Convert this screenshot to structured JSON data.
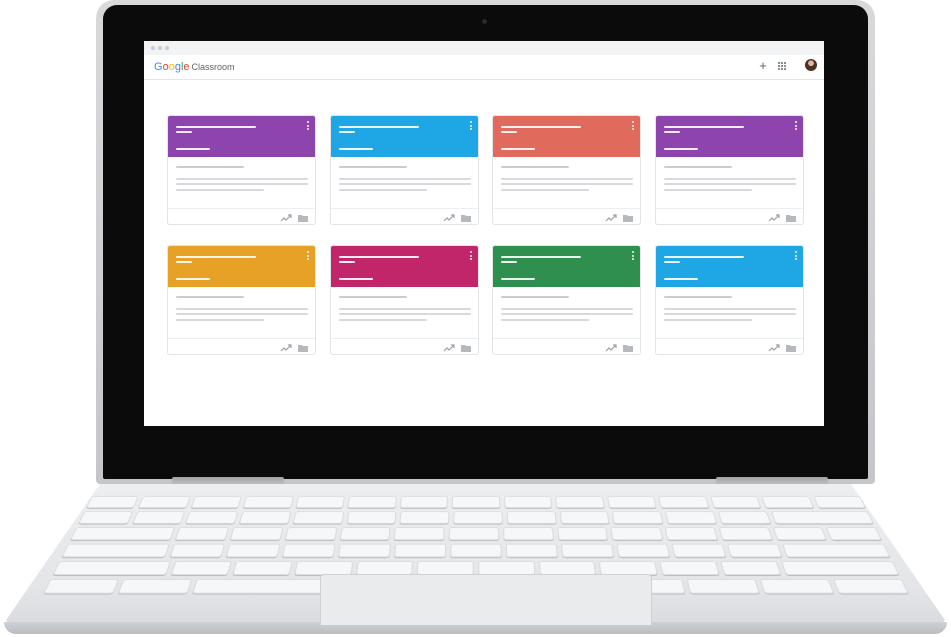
{
  "app": {
    "logo_letters": [
      {
        "char": "G",
        "color": "#4285f4"
      },
      {
        "char": "o",
        "color": "#ea4335"
      },
      {
        "char": "o",
        "color": "#fbbc05"
      },
      {
        "char": "g",
        "color": "#4285f4"
      },
      {
        "char": "l",
        "color": "#34a853"
      },
      {
        "char": "e",
        "color": "#ea4335"
      }
    ],
    "product_name": "Classroom"
  },
  "toolbar": {
    "icons": [
      "plus-icon",
      "apps-grid-icon",
      "avatar"
    ],
    "plus_glyph": "+"
  },
  "cards": [
    {
      "color": "#8e44ad",
      "footer_icons": [
        "trend-icon",
        "folder-icon"
      ]
    },
    {
      "color": "#1ea7e4",
      "footer_icons": [
        "trend-icon",
        "folder-icon"
      ]
    },
    {
      "color": "#e06b5c",
      "footer_icons": [
        "trend-icon",
        "folder-icon"
      ]
    },
    {
      "color": "#8e44ad",
      "footer_icons": [
        "trend-icon",
        "folder-icon"
      ]
    },
    {
      "color": "#e7a127",
      "footer_icons": [
        "trend-icon",
        "folder-icon"
      ]
    },
    {
      "color": "#c2266a",
      "footer_icons": [
        "trend-icon",
        "folder-icon"
      ]
    },
    {
      "color": "#2f8f4e",
      "footer_icons": [
        "trend-icon",
        "folder-icon"
      ]
    },
    {
      "color": "#1ea7e4",
      "footer_icons": [
        "trend-icon",
        "folder-icon"
      ]
    }
  ]
}
